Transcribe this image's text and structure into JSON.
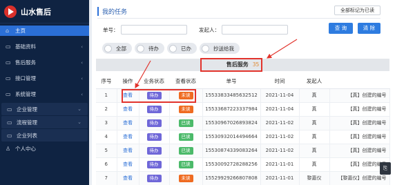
{
  "app": {
    "title": "山水售后"
  },
  "sidebar": {
    "items": [
      {
        "label": "主页",
        "icon": "home-icon",
        "glyph": "⌂",
        "active": true
      },
      {
        "label": "基础资料",
        "icon": "folder-icon",
        "glyph": "▭",
        "chevron": "‹"
      },
      {
        "label": "售后服务",
        "icon": "service-icon",
        "glyph": "▭",
        "chevron": "‹"
      },
      {
        "label": "接口管理",
        "icon": "folder-icon",
        "glyph": "▭",
        "chevron": "‹"
      },
      {
        "label": "系统管理",
        "icon": "folder-icon",
        "glyph": "▭",
        "chevron": "‹"
      },
      {
        "label": "企业管理",
        "icon": "folder-icon",
        "glyph": "▭",
        "chevron": "⌄"
      },
      {
        "label": "流程管理",
        "icon": "folder-icon",
        "glyph": "▭",
        "chevron": "⌄"
      },
      {
        "label": "企业列表",
        "icon": "list-icon",
        "glyph": "▭"
      },
      {
        "label": "个人中心",
        "icon": "user-icon",
        "glyph": "♙"
      }
    ]
  },
  "header": {
    "title": "我的任务",
    "mark_all_read": "全部标记为已读"
  },
  "filters": {
    "order_no_label": "单号：",
    "initiator_label": "发起人：",
    "query_button": "查 询",
    "clear_button": "清 除"
  },
  "tabs": [
    {
      "label": "全部"
    },
    {
      "label": "待办"
    },
    {
      "label": "已办"
    },
    {
      "label": "抄送给我"
    }
  ],
  "service": {
    "label": "售后服务",
    "count": "35"
  },
  "table": {
    "columns": [
      "序号",
      "操作",
      "业务状态",
      "查看状态",
      "单号",
      "时间",
      "发起人",
      ""
    ],
    "rows": [
      {
        "no": "1",
        "action": "查看",
        "status": "待办",
        "view": "未读",
        "order": "15533833485632512",
        "time": "2021-11-04",
        "initiator": "真",
        "desc": "【真】创建的编号"
      },
      {
        "no": "2",
        "action": "查看",
        "status": "待办",
        "view": "未读",
        "order": "15533687223337984",
        "time": "2021-11-04",
        "initiator": "真",
        "desc": "【真】创建的编号"
      },
      {
        "no": "3",
        "action": "查看",
        "status": "待办",
        "view": "已读",
        "order": "15530967026893824",
        "time": "2021-11-02",
        "initiator": "真",
        "desc": "【真】创建的编号"
      },
      {
        "no": "4",
        "action": "查看",
        "status": "待办",
        "view": "已读",
        "order": "15530932014494664",
        "time": "2021-11-02",
        "initiator": "真",
        "desc": "【真】创建的编号"
      },
      {
        "no": "5",
        "action": "查看",
        "status": "待办",
        "view": "已读",
        "order": "15530874339083264",
        "time": "2021-11-02",
        "initiator": "真",
        "desc": "【真】创建的编号"
      },
      {
        "no": "6",
        "action": "查看",
        "status": "待办",
        "view": "已读",
        "order": "15530092728288256",
        "time": "2021-11-01",
        "initiator": "真",
        "desc": "【真】创建的编号"
      },
      {
        "no": "7",
        "action": "查看",
        "status": "待办",
        "view": "未读",
        "order": "15529929266807808",
        "time": "2021-11-01",
        "initiator": "黎嘉仪",
        "desc": "【黎嘉仪】创建的编号"
      }
    ]
  },
  "colors": {
    "sidebar_bg": "#0f2342",
    "accent": "#2b6fd6",
    "pending": "#6f67d8",
    "unread": "#ef6b21",
    "read": "#4cba6a",
    "annotation": "#e2332c"
  }
}
